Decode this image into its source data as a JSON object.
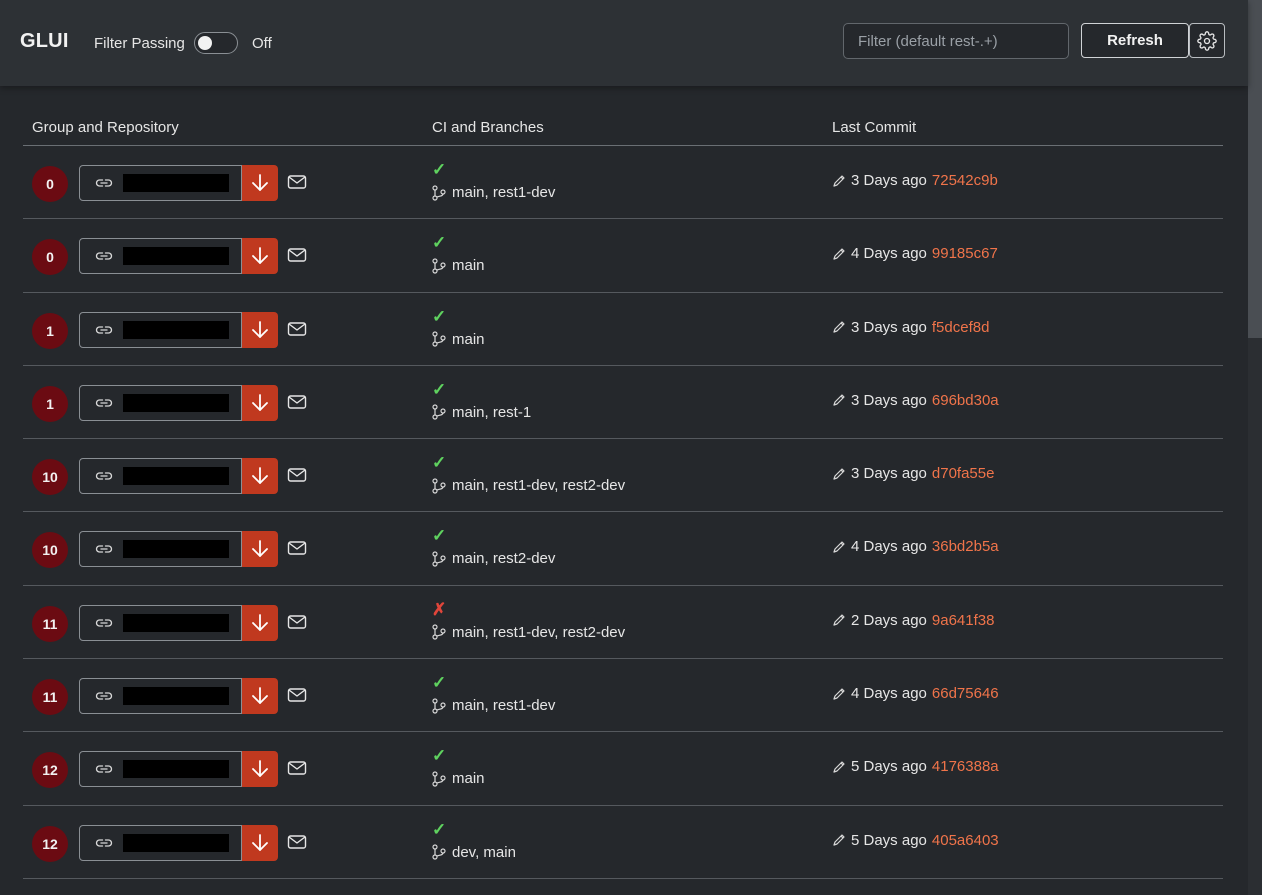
{
  "header": {
    "brand": "GLUI",
    "filter_passing_label": "Filter Passing",
    "toggle_state": "Off",
    "search_placeholder": "Filter (default rest-.+)",
    "refresh_label": "Refresh",
    "settings_icon": "gear-icon"
  },
  "table": {
    "columns": [
      "Group and Repository",
      "CI and Branches",
      "Last Commit"
    ],
    "rows": [
      {
        "count": "0",
        "ci": "✓",
        "ci_status": "pass",
        "branches": "main, rest1-dev",
        "age": "3 Days ago",
        "hash": "72542c9b"
      },
      {
        "count": "0",
        "ci": "✓",
        "ci_status": "pass",
        "branches": "main",
        "age": "4 Days ago",
        "hash": "99185c67"
      },
      {
        "count": "1",
        "ci": "✓",
        "ci_status": "pass",
        "branches": "main",
        "age": "3 Days ago",
        "hash": "f5dcef8d"
      },
      {
        "count": "1",
        "ci": "✓",
        "ci_status": "pass",
        "branches": "main, rest-1",
        "age": "3 Days ago",
        "hash": "696bd30a"
      },
      {
        "count": "10",
        "ci": "✓",
        "ci_status": "pass",
        "branches": "main, rest1-dev, rest2-dev",
        "age": "3 Days ago",
        "hash": "d70fa55e"
      },
      {
        "count": "10",
        "ci": "✓",
        "ci_status": "pass",
        "branches": "main, rest2-dev",
        "age": "4 Days ago",
        "hash": "36bd2b5a"
      },
      {
        "count": "11",
        "ci": "✗",
        "ci_status": "fail",
        "branches": "main, rest1-dev, rest2-dev",
        "age": "2 Days ago",
        "hash": "9a641f38"
      },
      {
        "count": "11",
        "ci": "✓",
        "ci_status": "pass",
        "branches": "main, rest1-dev",
        "age": "4 Days ago",
        "hash": "66d75646"
      },
      {
        "count": "12",
        "ci": "✓",
        "ci_status": "pass",
        "branches": "main",
        "age": "5 Days ago",
        "hash": "4176388a"
      },
      {
        "count": "12",
        "ci": "✓",
        "ci_status": "pass",
        "branches": "dev, main",
        "age": "5 Days ago",
        "hash": "405a6403"
      }
    ]
  },
  "colors": {
    "badge": "#6b0b12",
    "download_button": "#c0391f",
    "ci_pass": "#5fd25f",
    "ci_fail": "#e0453a",
    "commit_hash": "#f0744a"
  }
}
